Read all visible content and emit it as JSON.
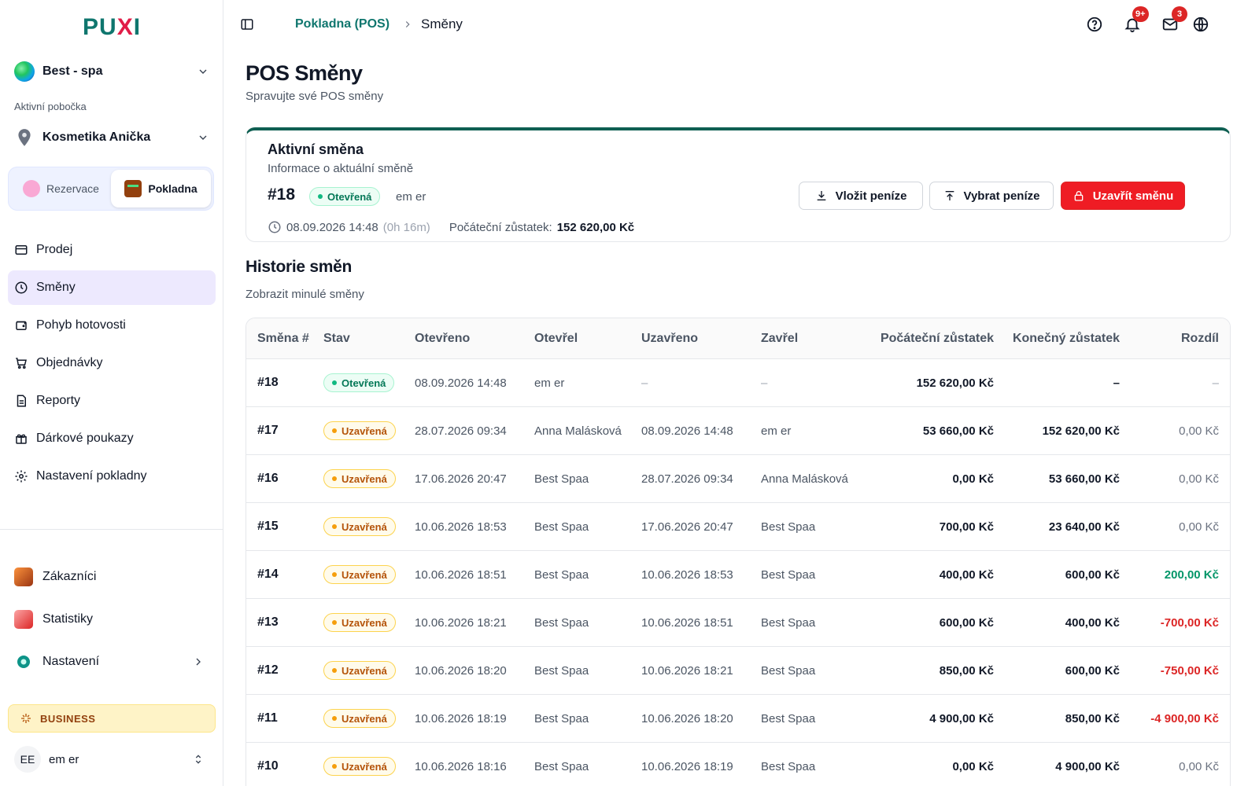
{
  "brand": {
    "logo_text": "PU",
    "logo_x": "X",
    "logo_i": "I"
  },
  "sidebar": {
    "org_name": "Best - spa",
    "branch_label": "Aktivní pobočka",
    "branch_name": "Kosmetika Anička",
    "modes": [
      {
        "label": "Rezervace",
        "active": false
      },
      {
        "label": "Pokladna",
        "active": true
      }
    ],
    "nav": [
      {
        "label": "Prodej",
        "icon": "card-icon",
        "active": false
      },
      {
        "label": "Směny",
        "icon": "clock-icon",
        "active": true
      },
      {
        "label": "Pohyb hotovosti",
        "icon": "wallet-icon",
        "active": false
      },
      {
        "label": "Objednávky",
        "icon": "cart-icon",
        "active": false
      },
      {
        "label": "Reporty",
        "icon": "report-icon",
        "active": false
      },
      {
        "label": "Dárkové poukazy",
        "icon": "gift-icon",
        "active": false
      },
      {
        "label": "Nastavení pokladny",
        "icon": "gear-icon",
        "active": false
      }
    ],
    "nav2": [
      {
        "label": "Zákazníci",
        "icon": "customers-icon"
      },
      {
        "label": "Statistiky",
        "icon": "statistics-icon"
      },
      {
        "label": "Nastavení",
        "icon": "settings-gear-icon"
      }
    ],
    "plan": "BUSINESS",
    "user": {
      "initials": "EE",
      "name": "em er"
    }
  },
  "topbar": {
    "breadcrumb": [
      "Pokladna (POS)",
      "Směny"
    ],
    "notifications_badge": "9+",
    "messages_badge": "3"
  },
  "page": {
    "title": "POS Směny",
    "subtitle": "Spravujte své POS směny"
  },
  "active_shift": {
    "title": "Aktivní směna",
    "subtitle": "Informace o aktuální směně",
    "number": "#18",
    "status": "Otevřená",
    "user": "em er",
    "opened_at": "08.09.2026 14:48",
    "duration": "(0h 16m)",
    "balance_label": "Počáteční zůstatek:",
    "balance_value": "152 620,00 Kč",
    "buttons": {
      "deposit": "Vložit peníze",
      "withdraw": "Vybrat peníze",
      "close": "Uzavřít směnu"
    }
  },
  "history": {
    "title": "Historie směn",
    "subtitle": "Zobrazit minulé směny",
    "columns": [
      "Směna #",
      "Stav",
      "Otevřeno",
      "Otevřel",
      "Uzavřeno",
      "Zavřel",
      "Počáteční zůstatek",
      "Konečný zůstatek",
      "Rozdíl"
    ],
    "rows": [
      {
        "id": "#18",
        "status": "Otevřená",
        "status_kind": "open",
        "opened": "08.09.2026 14:48",
        "opened_by": "em er",
        "closed": "–",
        "closed_by": "–",
        "start": "152 620,00 Kč",
        "end": "–",
        "diff": "–",
        "diff_kind": "dash"
      },
      {
        "id": "#17",
        "status": "Uzavřená",
        "status_kind": "closed",
        "opened": "28.07.2026 09:34",
        "opened_by": "Anna Malásková",
        "closed": "08.09.2026 14:48",
        "closed_by": "em er",
        "start": "53 660,00 Kč",
        "end": "152 620,00 Kč",
        "diff": "0,00 Kč",
        "diff_kind": "zero"
      },
      {
        "id": "#16",
        "status": "Uzavřená",
        "status_kind": "closed",
        "opened": "17.06.2026 20:47",
        "opened_by": "Best Spaa",
        "closed": "28.07.2026 09:34",
        "closed_by": "Anna Malásková",
        "start": "0,00 Kč",
        "end": "53 660,00 Kč",
        "diff": "0,00 Kč",
        "diff_kind": "zero"
      },
      {
        "id": "#15",
        "status": "Uzavřená",
        "status_kind": "closed",
        "opened": "10.06.2026 18:53",
        "opened_by": "Best Spaa",
        "closed": "17.06.2026 20:47",
        "closed_by": "Best Spaa",
        "start": "700,00 Kč",
        "end": "23 640,00 Kč",
        "diff": "0,00 Kč",
        "diff_kind": "zero"
      },
      {
        "id": "#14",
        "status": "Uzavřená",
        "status_kind": "closed",
        "opened": "10.06.2026 18:51",
        "opened_by": "Best Spaa",
        "closed": "10.06.2026 18:53",
        "closed_by": "Best Spaa",
        "start": "400,00 Kč",
        "end": "600,00 Kč",
        "diff": "200,00 Kč",
        "diff_kind": "pos"
      },
      {
        "id": "#13",
        "status": "Uzavřená",
        "status_kind": "closed",
        "opened": "10.06.2026 18:21",
        "opened_by": "Best Spaa",
        "closed": "10.06.2026 18:51",
        "closed_by": "Best Spaa",
        "start": "600,00 Kč",
        "end": "400,00 Kč",
        "diff": "-700,00 Kč",
        "diff_kind": "neg"
      },
      {
        "id": "#12",
        "status": "Uzavřená",
        "status_kind": "closed",
        "opened": "10.06.2026 18:20",
        "opened_by": "Best Spaa",
        "closed": "10.06.2026 18:21",
        "closed_by": "Best Spaa",
        "start": "850,00 Kč",
        "end": "600,00 Kč",
        "diff": "-750,00 Kč",
        "diff_kind": "neg"
      },
      {
        "id": "#11",
        "status": "Uzavřená",
        "status_kind": "closed",
        "opened": "10.06.2026 18:19",
        "opened_by": "Best Spaa",
        "closed": "10.06.2026 18:20",
        "closed_by": "Best Spaa",
        "start": "4 900,00 Kč",
        "end": "850,00 Kč",
        "diff": "-4 900,00 Kč",
        "diff_kind": "neg"
      },
      {
        "id": "#10",
        "status": "Uzavřená",
        "status_kind": "closed",
        "opened": "10.06.2026 18:16",
        "opened_by": "Best Spaa",
        "closed": "10.06.2026 18:19",
        "closed_by": "Best Spaa",
        "start": "0,00 Kč",
        "end": "4 900,00 Kč",
        "diff": "0,00 Kč",
        "diff_kind": "zero"
      }
    ]
  },
  "colors": {
    "brand_teal": "#0f766e",
    "danger": "#ef1c24",
    "active_nav": "#ede9fe",
    "positive": "#059669",
    "negative": "#dc2626"
  }
}
